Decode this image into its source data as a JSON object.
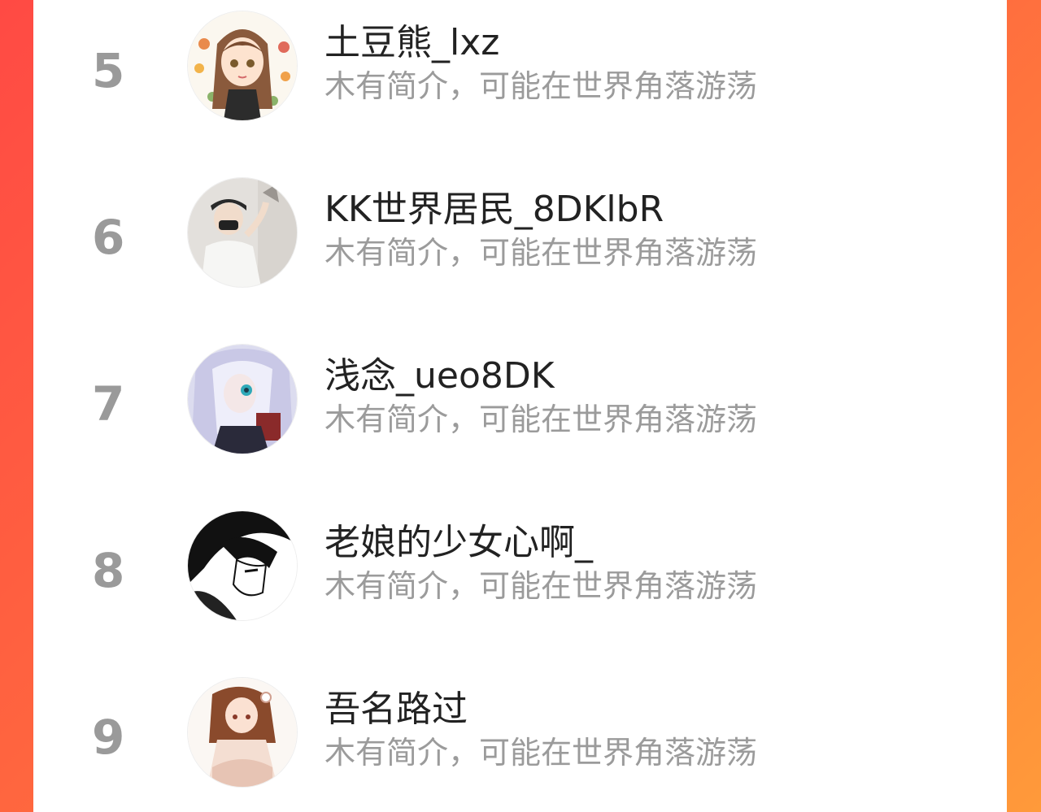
{
  "colors": {
    "background_gradient_start": "#ff4a44",
    "background_gradient_end": "#ff9a3a",
    "card": "#ffffff",
    "rank": "#9a9a9a",
    "name": "#222222",
    "bio": "#9b9b9b"
  },
  "ranking": {
    "items": [
      {
        "rank": "5",
        "name": "土豆熊_lxz",
        "bio": "木有简介，可能在世界角落游荡",
        "avatar_icon": "avatar-anime-girl-flowers-icon"
      },
      {
        "rank": "6",
        "name": "KK世界居民_8DKlbR",
        "bio": "木有简介，可能在世界角落游荡",
        "avatar_icon": "avatar-masked-man-icon"
      },
      {
        "rank": "7",
        "name": "浅念_ueo8DK",
        "bio": "木有简介，可能在世界角落游荡",
        "avatar_icon": "avatar-silver-hair-anime-icon"
      },
      {
        "rank": "8",
        "name": "老娘的少女心啊_",
        "bio": "木有简介，可能在世界角落游荡",
        "avatar_icon": "avatar-manga-boy-icon"
      },
      {
        "rank": "9",
        "name": "吾名路过",
        "bio": "木有简介，可能在世界角落游荡",
        "avatar_icon": "avatar-anime-girl-sitting-icon"
      }
    ]
  }
}
